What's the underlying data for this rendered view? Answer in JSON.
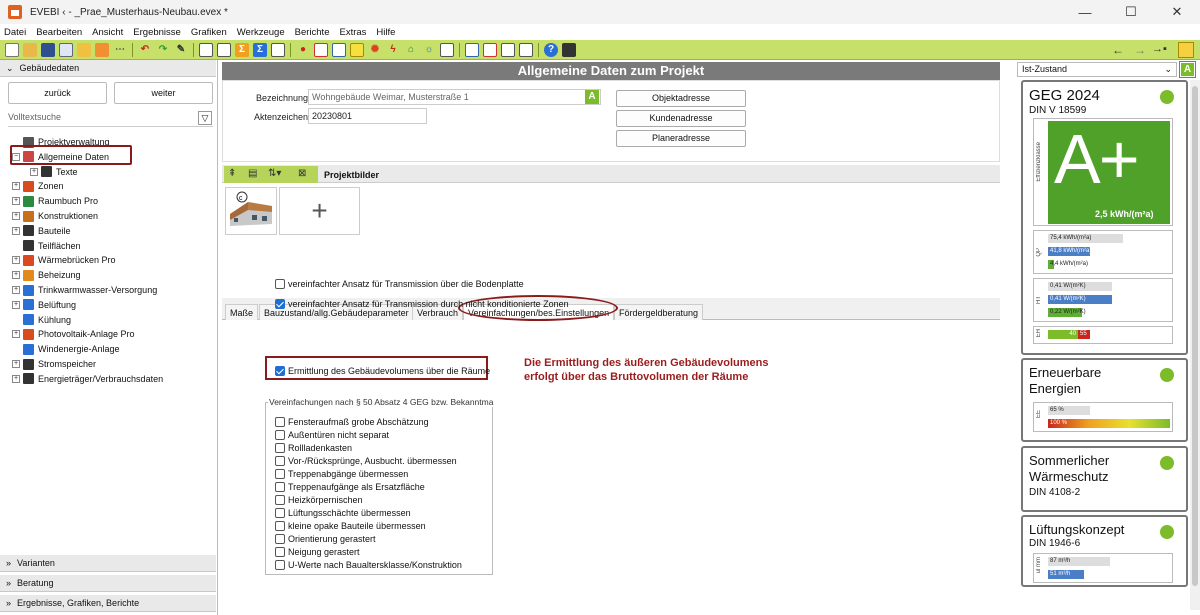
{
  "window": {
    "title": "EVEBI ‹ - _Prae_Musterhaus-Neubau.evex *",
    "min": "—",
    "max": "☐",
    "close": "✕"
  },
  "menu": [
    "Datei",
    "Bearbeiten",
    "Ansicht",
    "Ergebnisse",
    "Grafiken",
    "Werkzeuge",
    "Berichte",
    "Extras",
    "Hilfe"
  ],
  "toolbar": {
    "nav_back": "←",
    "nav_forward": "→",
    "nav_jump": "→▪"
  },
  "left": {
    "section_title": "Gebäudedaten",
    "back_label": "zurück",
    "forward_label": "weiter",
    "search_placeholder": "Volltextsuche",
    "tree": [
      {
        "label": "Projektverwaltung",
        "indent": 1,
        "expander": "",
        "icon": "gear-icon",
        "color": "#555"
      },
      {
        "label": "Allgemeine Daten",
        "indent": 0,
        "expander": "−",
        "icon": "house-icon",
        "color": "#c44"
      },
      {
        "label": "Texte",
        "indent": 2,
        "expander": "+",
        "icon": "document-icon",
        "color": "#333"
      },
      {
        "label": "Zonen",
        "indent": 0,
        "expander": "+",
        "icon": "zone-icon",
        "color": "#d94a1e"
      },
      {
        "label": "Raumbuch Pro",
        "indent": 0,
        "expander": "+",
        "icon": "room-icon",
        "color": "#2b8a3e"
      },
      {
        "label": "Konstruktionen",
        "indent": 0,
        "expander": "+",
        "icon": "wall-icon",
        "color": "#c7701a"
      },
      {
        "label": "Bauteile",
        "indent": 0,
        "expander": "+",
        "icon": "component-icon",
        "color": "#333"
      },
      {
        "label": "Teilflächen",
        "indent": 1,
        "expander": "",
        "icon": "area-icon",
        "color": "#333"
      },
      {
        "label": "Wärmebrücken Pro",
        "indent": 0,
        "expander": "+",
        "icon": "thermal-bridge-icon",
        "color": "#d94a1e"
      },
      {
        "label": "Beheizung",
        "indent": 0,
        "expander": "+",
        "icon": "heating-icon",
        "color": "#e08a1a"
      },
      {
        "label": "Trinkwarmwasser-Versorgung",
        "indent": 0,
        "expander": "+",
        "icon": "water-drop-icon",
        "color": "#2a6fd6"
      },
      {
        "label": "Belüftung",
        "indent": 0,
        "expander": "+",
        "icon": "fan-icon",
        "color": "#2a6fd6"
      },
      {
        "label": "Kühlung",
        "indent": 1,
        "expander": "",
        "icon": "snowflake-icon",
        "color": "#2a6fd6"
      },
      {
        "label": "Photovoltaik-Anlage Pro",
        "indent": 0,
        "expander": "+",
        "icon": "solar-icon",
        "color": "#d94a1e"
      },
      {
        "label": "Windenergie-Anlage",
        "indent": 1,
        "expander": "",
        "icon": "wind-icon",
        "color": "#2a6fd6"
      },
      {
        "label": "Stromspeicher",
        "indent": 0,
        "expander": "+",
        "icon": "battery-icon",
        "color": "#333"
      },
      {
        "label": "Energieträger/Verbrauchsdaten",
        "indent": 0,
        "expander": "+",
        "icon": "energy-icon",
        "color": "#333"
      }
    ],
    "bottom_sections": [
      "Varianten",
      "Beratung",
      "Ergebnisse, Grafiken, Berichte"
    ]
  },
  "main": {
    "title": "Allgemeine Daten zum Projekt",
    "bezeichnung_label": "Bezeichnung",
    "bezeichnung_value": "Wohngebäude Weimar, Musterstraße 1",
    "aktenzeichen_label": "Aktenzeichen",
    "aktenzeichen_value": "20230801",
    "objektadresse": "Objektadresse",
    "kundenadresse": "Kundenadresse",
    "planeradresse": "Planeradresse",
    "projektbilder": "Projektbilder",
    "add_image": "+",
    "tabs": [
      "Maße",
      "Bauzustand/allg.Gebäudeparameter",
      "Verbrauch",
      "Vereinfachungen/bes.Einstellungen",
      "Fördergeldberatung"
    ],
    "options": [
      {
        "label": "vereinfachter Ansatz für Transmission über die Bodenplatte",
        "checked": false
      },
      {
        "label": "vereinfachter Ansatz für Transmission durch nicht konditionierte Zonen",
        "checked": true
      }
    ],
    "volume_option": {
      "label": "Ermittlung des Gebäudevolumens über die Räume",
      "checked": true
    },
    "annotation_line1": "Die Ermittlung des äußeren Gebäudevolumens",
    "annotation_line2": "erfolgt über das Bruttovolumen der Räume",
    "group_title": "Vereinfachungen nach § 50 Absatz 4 GEG bzw. Bekanntma",
    "group_items": [
      "Fensteraufmaß grobe Abschätzung",
      "Außentüren nicht separat",
      "Rollladenkasten",
      "Vor-/Rücksprünge, Ausbucht. übermessen",
      "Treppenabgänge übermessen",
      "Treppenaufgänge als Ersatzfläche",
      "Heizkörpernischen",
      "Lüftungsschächte übermessen",
      "kleine opake Bauteile übermessen",
      "Orientierung gerastert",
      "Neigung gerastert",
      "U-Werte nach Baualtersklasse/Konstruktion"
    ]
  },
  "right": {
    "state_select": "Ist-Zustand",
    "geg_title": "GEG 2024",
    "geg_sub": "DIN V 18599",
    "efficiency_label": "Effizienzklasse",
    "efficiency_class": "A+",
    "efficiency_value": "2,5 kWh/(m²a)",
    "qp_label": "QP",
    "qp_bars": [
      "75,4 kWh/(m²a)",
      "41,8 kWh/(m²a)",
      "4,4 kWh/(m²a)"
    ],
    "ht_label": "HT",
    "ht_bars": [
      "0,41 W/(m²K)",
      "0,41 W/(m²K)",
      "0,22 W/(m²K)"
    ],
    "eh_label": "EH",
    "eh_values": [
      "40",
      "55"
    ],
    "ee_title_1": "Erneuerbare",
    "ee_title_2": "Energien",
    "ee_label": "EE",
    "ee_bars": [
      "65 %",
      "100 %"
    ],
    "sw_title_1": "Sommerlicher",
    "sw_title_2": "Wärmeschutz",
    "sw_sub": "DIN 4108-2",
    "lk_title": "Lüftungskonzept",
    "lk_sub": "DIN 1946-6",
    "lk_label": "ul mm",
    "lk_bars": [
      "87 m³/h",
      "51 m³/h"
    ],
    "status_color": "#7cbb2a"
  }
}
